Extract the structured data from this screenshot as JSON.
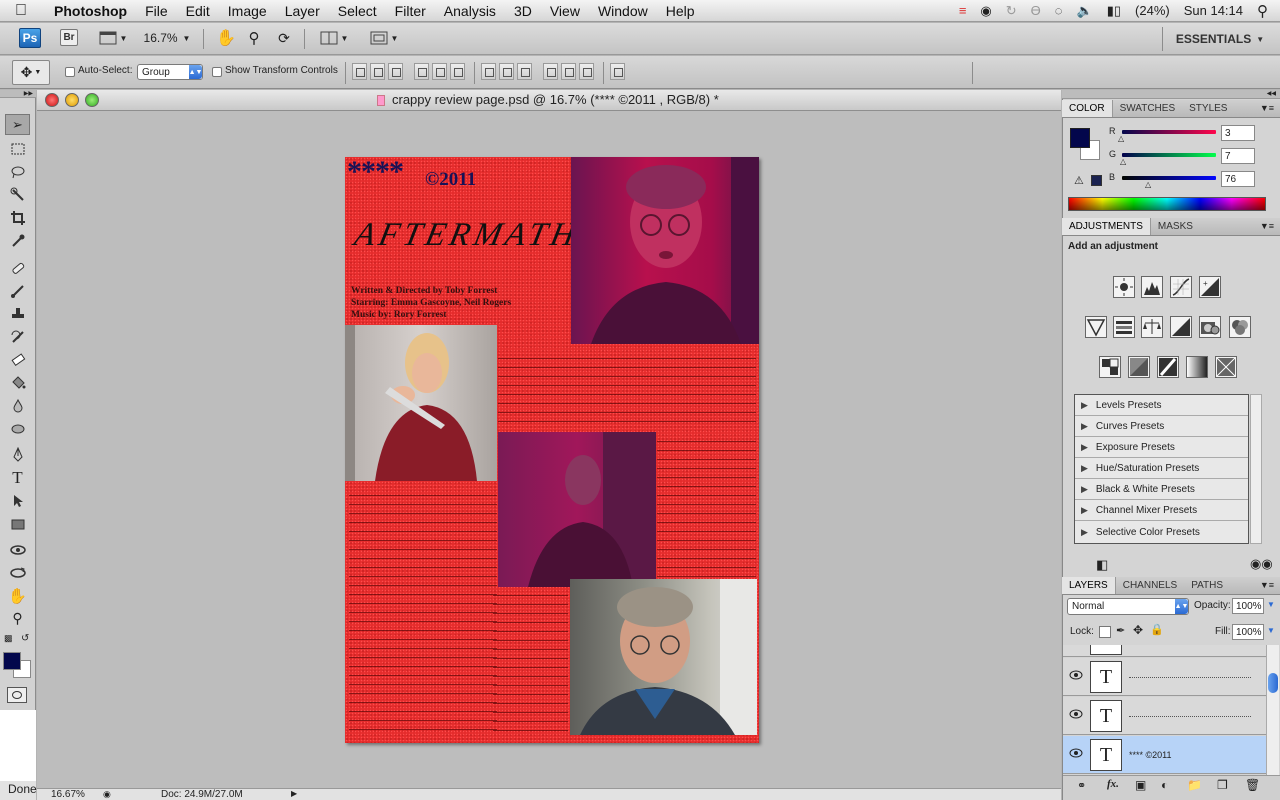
{
  "menubar": {
    "app_name": "Photoshop",
    "items": [
      "File",
      "Edit",
      "Image",
      "Layer",
      "Select",
      "Filter",
      "Analysis",
      "3D",
      "View",
      "Window",
      "Help"
    ],
    "battery": "(24%)",
    "clock": "Sun 14:14"
  },
  "appbar": {
    "ps_logo": "Ps",
    "bridge_logo": "Br",
    "zoom": "16.7%",
    "workspace": "ESSENTIALS"
  },
  "options": {
    "auto_select_label": "Auto-Select:",
    "auto_select_value": "Group",
    "transform_label": "Show Transform Controls"
  },
  "document": {
    "title": "crappy review page.psd @ 16.7% (**** ©2011 , RGB/8) *",
    "stars": "****",
    "copyright": "©2011",
    "headline": "AFTERMATH",
    "credits": [
      "Written & Directed by Toby Forrest",
      "Starring: Emma Gascoyne, Neil Rogers",
      "Music by: Rory Forrest"
    ]
  },
  "status": {
    "zoom": "16.67%",
    "doc_size": "Doc: 24.9M/27.0M",
    "done": "Done"
  },
  "color_panel": {
    "tabs": [
      "COLOR",
      "SWATCHES",
      "STYLES"
    ],
    "r_label": "R",
    "g_label": "G",
    "b_label": "B",
    "r": "3",
    "g": "7",
    "b": "76",
    "foreground": "#03074c"
  },
  "adjustments_panel": {
    "tabs": [
      "ADJUSTMENTS",
      "MASKS"
    ],
    "heading": "Add an adjustment",
    "presets": [
      "Levels Presets",
      "Curves Presets",
      "Exposure Presets",
      "Hue/Saturation Presets",
      "Black & White Presets",
      "Channel Mixer Presets",
      "Selective Color Presets"
    ]
  },
  "layers_panel": {
    "tabs": [
      "LAYERS",
      "CHANNELS",
      "PATHS"
    ],
    "blend_mode": "Normal",
    "opacity_label": "Opacity:",
    "opacity": "100%",
    "lock_label": "Lock:",
    "fill_label": "Fill:",
    "fill": "100%",
    "layers": [
      {
        "thumb": "T",
        "name": ""
      },
      {
        "thumb": "T",
        "name": ""
      },
      {
        "thumb": "T",
        "name": "**** ©2011"
      }
    ]
  }
}
